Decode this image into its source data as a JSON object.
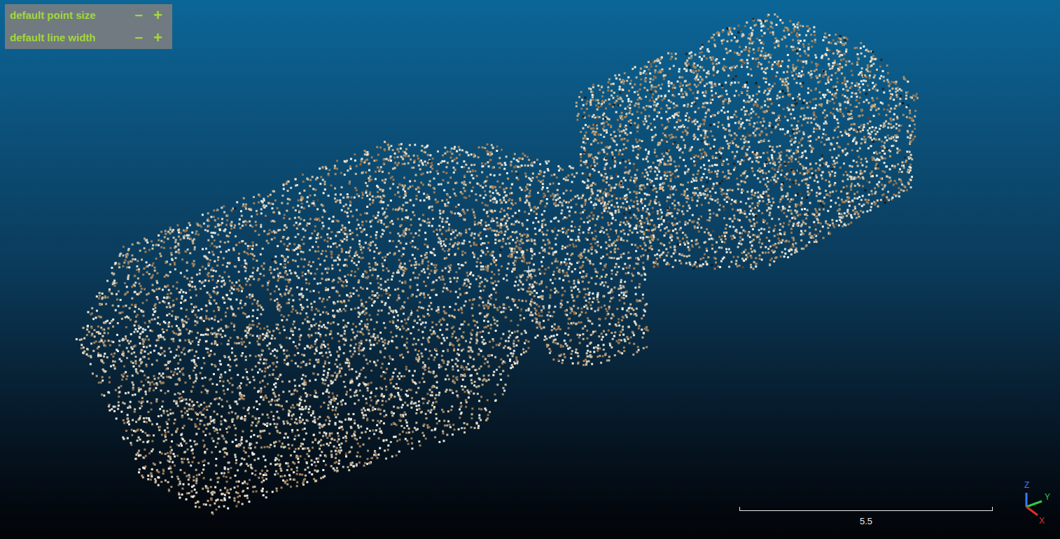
{
  "overlay_panel": {
    "rows": [
      {
        "label": "default point size",
        "minus": "−",
        "plus": "+"
      },
      {
        "label": "default line width",
        "minus": "−",
        "plus": "+"
      }
    ]
  },
  "scale_bar": {
    "value": "5.5"
  },
  "axis_gizmo": {
    "axes": [
      {
        "label": "Z",
        "color": "#3b7bff"
      },
      {
        "label": "Y",
        "color": "#2ecc40"
      },
      {
        "label": "X",
        "color": "#e0302a"
      }
    ]
  }
}
